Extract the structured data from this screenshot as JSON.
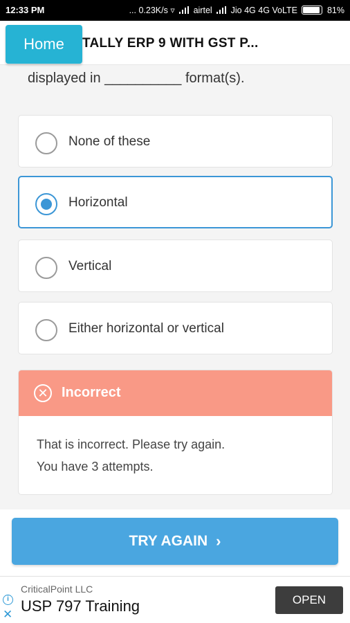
{
  "status_bar": {
    "time": "12:33 PM",
    "network_info": "... 0.23K/s",
    "carrier1": "airtel",
    "carrier2": "Jio 4G 4G VoLTE",
    "battery": "81%"
  },
  "header": {
    "home_label": "Home",
    "course_title": "TALLY ERP 9 WITH GST P..."
  },
  "question": {
    "text": "displayed in __________ format(s)."
  },
  "options": [
    {
      "label": "None of these",
      "selected": false
    },
    {
      "label": "Horizontal",
      "selected": true
    },
    {
      "label": "Vertical",
      "selected": false
    },
    {
      "label": "Either horizontal or vertical",
      "selected": false
    }
  ],
  "feedback": {
    "title": "Incorrect",
    "message": "That is incorrect. Please try again.",
    "attempts": "You have 3 attempts."
  },
  "actions": {
    "try_again_label": "TRY AGAIN"
  },
  "ad": {
    "advertiser": "CriticalPoint LLC",
    "headline": "USP 797 Training",
    "cta_label": "OPEN"
  },
  "colors": {
    "home_button": "#26b3d4",
    "accent_blue": "#3b96d6",
    "incorrect_header": "#f99986",
    "try_again_button": "#4aa6e0"
  }
}
